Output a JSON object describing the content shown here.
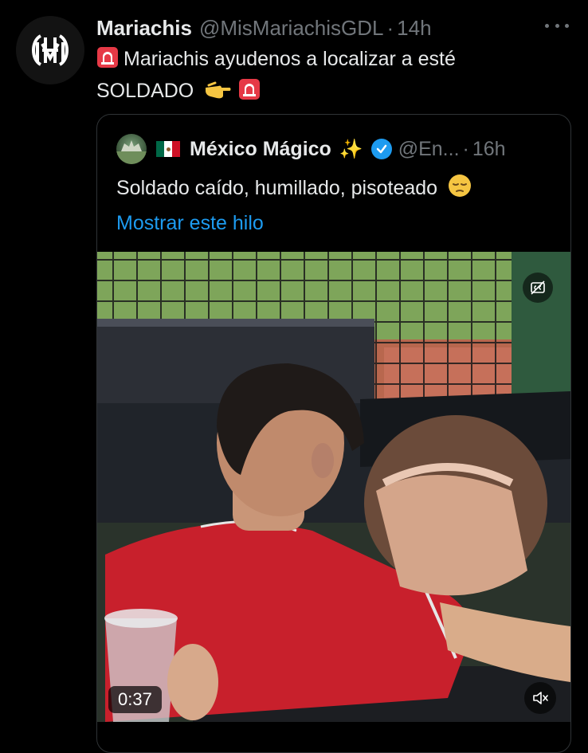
{
  "tweet": {
    "author_name": "Mariachis",
    "handle": "@MisMariachisGDL",
    "separator": "·",
    "time": "14h",
    "text_line1": "Mariachis ayudenos a localizar a esté",
    "text_line2": "SOLDADO",
    "icons": [
      "siren-icon",
      "pointing-hand-icon",
      "siren-icon"
    ]
  },
  "quote": {
    "author_name": "México Mágico",
    "handle": "@En...",
    "separator": "·",
    "time": "16h",
    "text": "Soldado caído, humillado, pisoteado",
    "text_emoji": "pensive-face-icon",
    "show_thread": "Mostrar este hilo"
  },
  "video": {
    "duration": "0:37",
    "controls": [
      "captions-icon",
      "muted-speaker-icon"
    ]
  },
  "colors": {
    "background": "#000000",
    "text": "#e7e9ea",
    "muted": "#71767b",
    "link": "#1d9bf0",
    "border": "#2f3336"
  }
}
